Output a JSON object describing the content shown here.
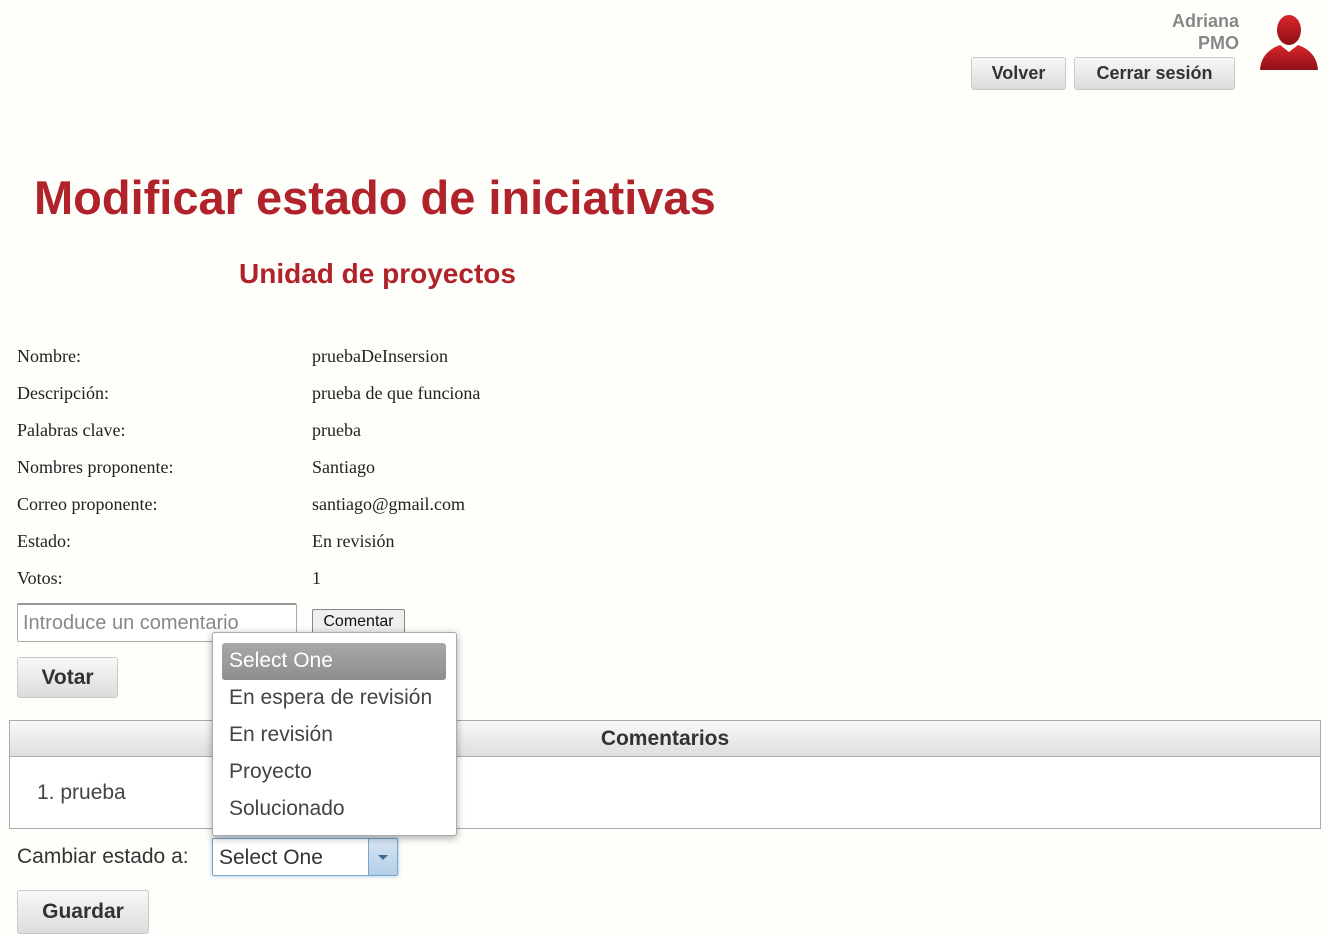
{
  "user": {
    "name": "Adriana",
    "role": "PMO"
  },
  "topnav": {
    "volver": "Volver",
    "cerrar_sesion": "Cerrar sesión"
  },
  "page": {
    "title": "Modificar estado de iniciativas",
    "subtitle": "Unidad de proyectos"
  },
  "fields": [
    {
      "label": "Nombre:",
      "value": "pruebaDeInsersion"
    },
    {
      "label": "Descripción:",
      "value": "prueba de que funciona"
    },
    {
      "label": "Palabras clave:",
      "value": "prueba"
    },
    {
      "label": "Nombres proponente:",
      "value": "Santiago"
    },
    {
      "label": "Correo proponente:",
      "value": "santiago@gmail.com"
    },
    {
      "label": "Estado:",
      "value": "En revisión"
    },
    {
      "label": "Votos:",
      "value": "1"
    }
  ],
  "comment_form": {
    "placeholder": "Introduce un comentario",
    "value": "",
    "submit_label": "Comentar"
  },
  "vote_button": "Votar",
  "comments": {
    "header": "Comentarios",
    "items": [
      "1. prueba"
    ]
  },
  "change_state": {
    "label": "Cambiar estado a:",
    "selected": "Select One",
    "options": [
      "Select One",
      "En espera de revisión",
      "En revisión",
      "Proyecto",
      "Solucionado"
    ],
    "highlighted_option": "Select One"
  },
  "save_button": "Guardar",
  "colors": {
    "accent": "#b1232b",
    "background": "#fefefb",
    "select_focus": "#7aa6c9"
  }
}
